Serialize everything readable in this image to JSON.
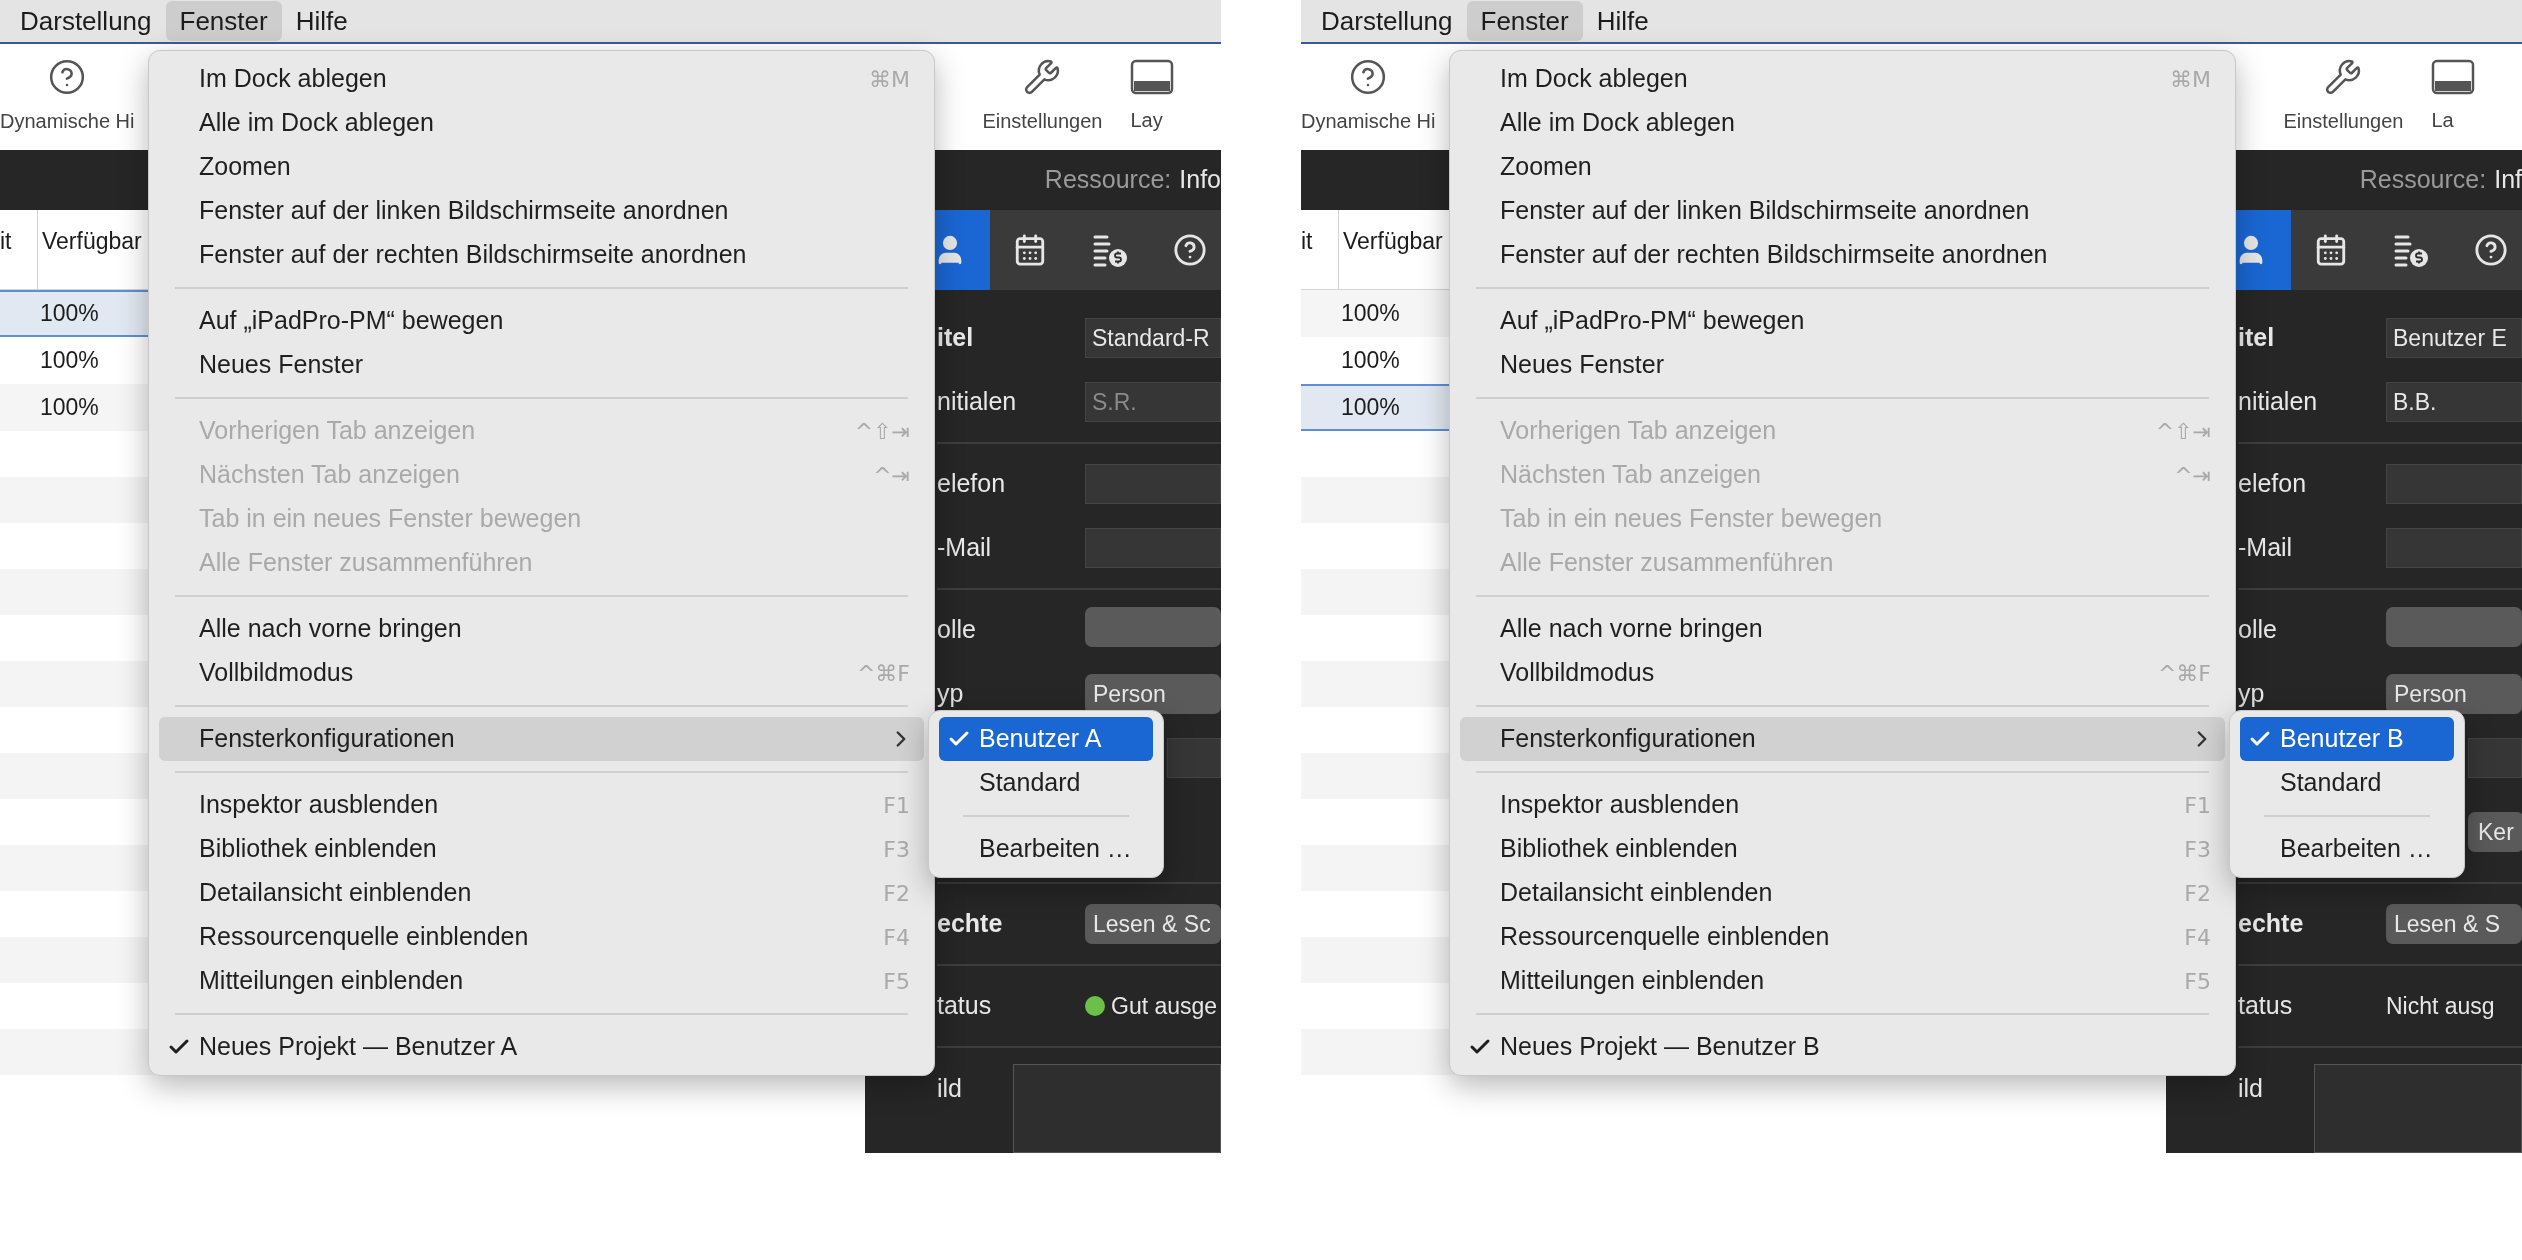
{
  "panels": [
    {
      "menu_bar": [
        {
          "label": "Darstellung",
          "selected": false
        },
        {
          "label": "Fenster",
          "selected": true
        },
        {
          "label": "Hilfe",
          "selected": false
        }
      ],
      "toolbar": [
        {
          "kind": "help",
          "label": "Dynamische Hi"
        },
        {
          "kind": "tools",
          "label": "Einstellungen"
        },
        {
          "kind": "layout",
          "label": "Lay"
        }
      ],
      "header": {
        "caption": "Ressource:",
        "value": "Info"
      },
      "table": {
        "columns": [
          "it",
          "Verfügbar"
        ],
        "rows": [
          {
            "column_2": "100%",
            "selected": true
          },
          {
            "column_2": "100%",
            "selected": false
          },
          {
            "column_2": "100%",
            "selected": false
          }
        ]
      },
      "inspector": {
        "tabs": [
          {
            "kind": "person",
            "selected": true
          },
          {
            "kind": "calendar",
            "selected": false
          },
          {
            "kind": "costs",
            "selected": false
          },
          {
            "kind": "help",
            "selected": false
          }
        ],
        "fields": [
          {
            "kind": "text",
            "label": "itel",
            "bold": true,
            "value": "Standard-R"
          },
          {
            "kind": "text",
            "label": "nitialen",
            "bold": false,
            "placeholder": "S.R."
          },
          {
            "kind": "divider"
          },
          {
            "kind": "text",
            "label": "elefon",
            "bold": false
          },
          {
            "kind": "text",
            "label": "-Mail",
            "bold": false
          },
          {
            "kind": "divider"
          },
          {
            "kind": "popup",
            "label": "olle",
            "bold": false
          },
          {
            "kind": "popup",
            "label": "yp",
            "bold": false,
            "value": "Person"
          },
          {
            "kind": "text"
          },
          {
            "kind": "divider"
          },
          {
            "kind": "popup",
            "label": "echte",
            "bold": true,
            "value": "Lesen & Sc"
          },
          {
            "kind": "divider"
          },
          {
            "kind": "status",
            "label": "tatus",
            "bold": false,
            "value": "Gut ausge",
            "color": "#6cc04a"
          },
          {
            "kind": "divider"
          },
          {
            "kind": "image",
            "label": "ild",
            "bold": false
          }
        ]
      },
      "menu": [
        {
          "kind": "item",
          "label": "Im Dock ablegen",
          "shortcut": "⌘M",
          "disabled": false,
          "checked": false,
          "selected": false
        },
        {
          "kind": "item",
          "label": "Alle im Dock ablegen",
          "disabled": false,
          "checked": false,
          "selected": false
        },
        {
          "kind": "item",
          "label": "Zoomen",
          "disabled": false,
          "checked": false,
          "selected": false
        },
        {
          "kind": "item",
          "label": "Fenster auf der linken Bildschirmseite anordnen",
          "disabled": false,
          "checked": false,
          "selected": false
        },
        {
          "kind": "item",
          "label": "Fenster auf der rechten Bildschirmseite anordnen",
          "disabled": false,
          "checked": false,
          "selected": false
        },
        {
          "kind": "separator"
        },
        {
          "kind": "item",
          "label": "Auf „iPadPro-PM“ bewegen",
          "disabled": false,
          "checked": false,
          "selected": false
        },
        {
          "kind": "item",
          "label": "Neues Fenster",
          "disabled": false,
          "checked": false,
          "selected": false
        },
        {
          "kind": "separator"
        },
        {
          "kind": "item",
          "label": "Vorherigen Tab anzeigen",
          "shortcut": "^⇧⇥",
          "disabled": true,
          "checked": false,
          "selected": false
        },
        {
          "kind": "item",
          "label": "Nächsten Tab anzeigen",
          "shortcut": "^⇥",
          "disabled": true,
          "checked": false,
          "selected": false
        },
        {
          "kind": "item",
          "label": "Tab in ein neues Fenster bewegen",
          "disabled": true,
          "checked": false,
          "selected": false
        },
        {
          "kind": "item",
          "label": "Alle Fenster zusammenführen",
          "disabled": true,
          "checked": false,
          "selected": false
        },
        {
          "kind": "separator"
        },
        {
          "kind": "item",
          "label": "Alle nach vorne bringen",
          "disabled": false,
          "checked": false,
          "selected": false
        },
        {
          "kind": "item",
          "label": "Vollbildmodus",
          "shortcut": "^⌘F",
          "disabled": false,
          "checked": false,
          "selected": false
        },
        {
          "kind": "separator"
        },
        {
          "kind": "submenu",
          "label": "Fensterkonfigurationen",
          "disabled": false,
          "checked": false,
          "selected": true
        },
        {
          "kind": "separator"
        },
        {
          "kind": "item",
          "label": "Inspektor ausblenden",
          "shortcut": "F1",
          "disabled": false,
          "checked": false,
          "selected": false
        },
        {
          "kind": "item",
          "label": "Bibliothek einblenden",
          "shortcut": "F3",
          "disabled": false,
          "checked": false,
          "selected": false
        },
        {
          "kind": "item",
          "label": "Detailansicht einblenden",
          "shortcut": "F2",
          "disabled": false,
          "checked": false,
          "selected": false
        },
        {
          "kind": "item",
          "label": "Ressourcenquelle einblenden",
          "shortcut": "F4",
          "disabled": false,
          "checked": false,
          "selected": false
        },
        {
          "kind": "item",
          "label": "Mitteilungen einblenden",
          "shortcut": "F5",
          "disabled": false,
          "checked": false,
          "selected": false
        },
        {
          "kind": "separator"
        },
        {
          "kind": "item",
          "label": "Neues Projekt — Benutzer A",
          "disabled": false,
          "checked": true,
          "selected": false
        }
      ],
      "submenu": [
        {
          "kind": "item",
          "label": "Benutzer A",
          "checked": true,
          "selected": true
        },
        {
          "kind": "item",
          "label": "Standard",
          "checked": false,
          "selected": false
        },
        {
          "kind": "separator"
        },
        {
          "kind": "item",
          "label": "Bearbeiten …",
          "checked": false,
          "selected": false
        }
      ]
    },
    {
      "menu_bar": [
        {
          "label": "Darstellung",
          "selected": false
        },
        {
          "label": "Fenster",
          "selected": true
        },
        {
          "label": "Hilfe",
          "selected": false
        }
      ],
      "toolbar": [
        {
          "kind": "help",
          "label": "Dynamische Hi"
        },
        {
          "kind": "tools",
          "label": "Einstellungen"
        },
        {
          "kind": "layout",
          "label": "La"
        }
      ],
      "header": {
        "caption": "Ressource:",
        "value": "Inf"
      },
      "table": {
        "columns": [
          "it",
          "Verfügbar"
        ],
        "rows": [
          {
            "column_2": "100%",
            "selected": false
          },
          {
            "column_2": "100%",
            "selected": false
          },
          {
            "column_2": "100%",
            "selected": true
          }
        ]
      },
      "inspector": {
        "tabs": [
          {
            "kind": "person",
            "selected": true
          },
          {
            "kind": "calendar",
            "selected": false
          },
          {
            "kind": "costs",
            "selected": false
          },
          {
            "kind": "help",
            "selected": false
          }
        ],
        "fields": [
          {
            "kind": "text",
            "label": "itel",
            "bold": true,
            "value": "Benutzer E"
          },
          {
            "kind": "text",
            "label": "nitialen",
            "bold": false,
            "value": "B.B."
          },
          {
            "kind": "divider"
          },
          {
            "kind": "text",
            "label": "elefon",
            "bold": false
          },
          {
            "kind": "text",
            "label": "-Mail",
            "bold": false
          },
          {
            "kind": "divider"
          },
          {
            "kind": "popup",
            "label": "olle",
            "bold": false
          },
          {
            "kind": "popup",
            "label": "yp",
            "bold": false,
            "value": "Person"
          },
          {
            "kind": "text"
          },
          {
            "kind": "button",
            "value": "Ker"
          },
          {
            "kind": "divider"
          },
          {
            "kind": "popup",
            "label": "echte",
            "bold": true,
            "value": "Lesen & S"
          },
          {
            "kind": "divider"
          },
          {
            "kind": "status",
            "label": "tatus",
            "bold": false,
            "value": "Nicht ausg"
          },
          {
            "kind": "divider"
          },
          {
            "kind": "image",
            "label": "ild",
            "bold": false
          }
        ]
      },
      "menu": [
        {
          "kind": "item",
          "label": "Im Dock ablegen",
          "shortcut": "⌘M",
          "disabled": false,
          "checked": false,
          "selected": false
        },
        {
          "kind": "item",
          "label": "Alle im Dock ablegen",
          "disabled": false,
          "checked": false,
          "selected": false
        },
        {
          "kind": "item",
          "label": "Zoomen",
          "disabled": false,
          "checked": false,
          "selected": false
        },
        {
          "kind": "item",
          "label": "Fenster auf der linken Bildschirmseite anordnen",
          "disabled": false,
          "checked": false,
          "selected": false
        },
        {
          "kind": "item",
          "label": "Fenster auf der rechten Bildschirmseite anordnen",
          "disabled": false,
          "checked": false,
          "selected": false
        },
        {
          "kind": "separator"
        },
        {
          "kind": "item",
          "label": "Auf „iPadPro-PM“ bewegen",
          "disabled": false,
          "checked": false,
          "selected": false
        },
        {
          "kind": "item",
          "label": "Neues Fenster",
          "disabled": false,
          "checked": false,
          "selected": false
        },
        {
          "kind": "separator"
        },
        {
          "kind": "item",
          "label": "Vorherigen Tab anzeigen",
          "shortcut": "^⇧⇥",
          "disabled": true,
          "checked": false,
          "selected": false
        },
        {
          "kind": "item",
          "label": "Nächsten Tab anzeigen",
          "shortcut": "^⇥",
          "disabled": true,
          "checked": false,
          "selected": false
        },
        {
          "kind": "item",
          "label": "Tab in ein neues Fenster bewegen",
          "disabled": true,
          "checked": false,
          "selected": false
        },
        {
          "kind": "item",
          "label": "Alle Fenster zusammenführen",
          "disabled": true,
          "checked": false,
          "selected": false
        },
        {
          "kind": "separator"
        },
        {
          "kind": "item",
          "label": "Alle nach vorne bringen",
          "disabled": false,
          "checked": false,
          "selected": false
        },
        {
          "kind": "item",
          "label": "Vollbildmodus",
          "shortcut": "^⌘F",
          "disabled": false,
          "checked": false,
          "selected": false
        },
        {
          "kind": "separator"
        },
        {
          "kind": "submenu",
          "label": "Fensterkonfigurationen",
          "disabled": false,
          "checked": false,
          "selected": true
        },
        {
          "kind": "separator"
        },
        {
          "kind": "item",
          "label": "Inspektor ausblenden",
          "shortcut": "F1",
          "disabled": false,
          "checked": false,
          "selected": false
        },
        {
          "kind": "item",
          "label": "Bibliothek einblenden",
          "shortcut": "F3",
          "disabled": false,
          "checked": false,
          "selected": false
        },
        {
          "kind": "item",
          "label": "Detailansicht einblenden",
          "shortcut": "F2",
          "disabled": false,
          "checked": false,
          "selected": false
        },
        {
          "kind": "item",
          "label": "Ressourcenquelle einblenden",
          "shortcut": "F4",
          "disabled": false,
          "checked": false,
          "selected": false
        },
        {
          "kind": "item",
          "label": "Mitteilungen einblenden",
          "shortcut": "F5",
          "disabled": false,
          "checked": false,
          "selected": false
        },
        {
          "kind": "separator"
        },
        {
          "kind": "item",
          "label": "Neues Projekt — Benutzer B",
          "disabled": false,
          "checked": true,
          "selected": false
        }
      ],
      "submenu": [
        {
          "kind": "item",
          "label": "Benutzer B",
          "checked": true,
          "selected": true
        },
        {
          "kind": "item",
          "label": "Standard",
          "checked": false,
          "selected": false
        },
        {
          "kind": "separator"
        },
        {
          "kind": "item",
          "label": "Bearbeiten …",
          "checked": false,
          "selected": false
        }
      ]
    }
  ]
}
